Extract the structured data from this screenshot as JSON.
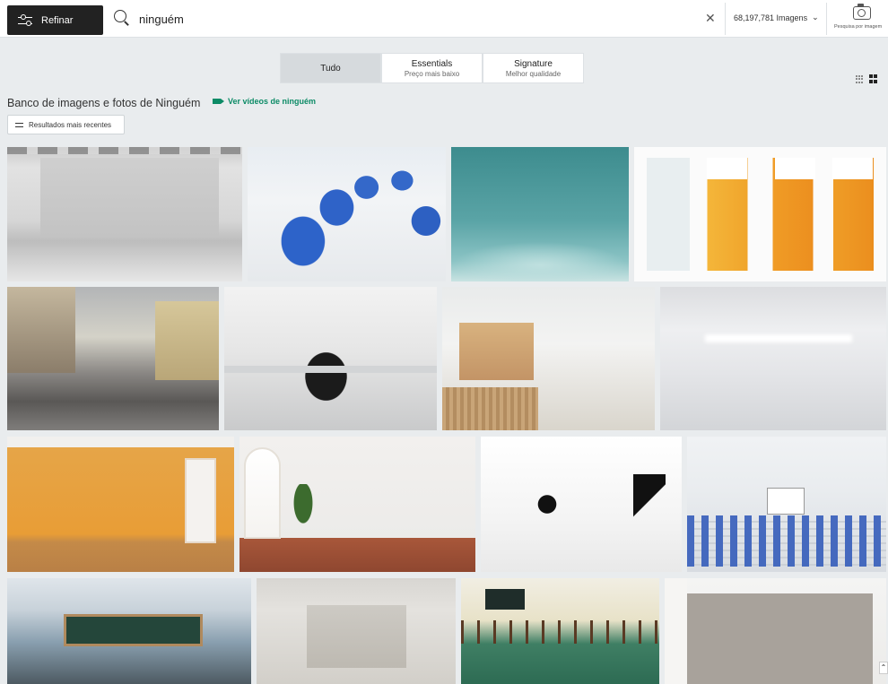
{
  "header": {
    "refine_label": "Refinar",
    "search_value": "ninguém",
    "count_label": "68,197,781 Imagens",
    "camera_label": "Pesquisa por imagem"
  },
  "tabs": [
    {
      "title": "Tudo",
      "subtitle": ""
    },
    {
      "title": "Essentials",
      "subtitle": "Preço mais baixo"
    },
    {
      "title": "Signature",
      "subtitle": "Melhor qualidade"
    }
  ],
  "page": {
    "title": "Banco de imagens e fotos de Ninguém",
    "video_link": "Ver vídeos de ninguém",
    "recent_button": "Resultados mais recentes"
  },
  "icons": [
    "sliders-icon",
    "search-icon",
    "close-icon",
    "chevron-down-icon",
    "camera-icon",
    "grid-view-icon",
    "mosaic-view-icon",
    "video-icon"
  ],
  "colors": {
    "accent": "#0c8b66",
    "refine_bg": "#222222",
    "active_tab": "#d6dadd"
  }
}
